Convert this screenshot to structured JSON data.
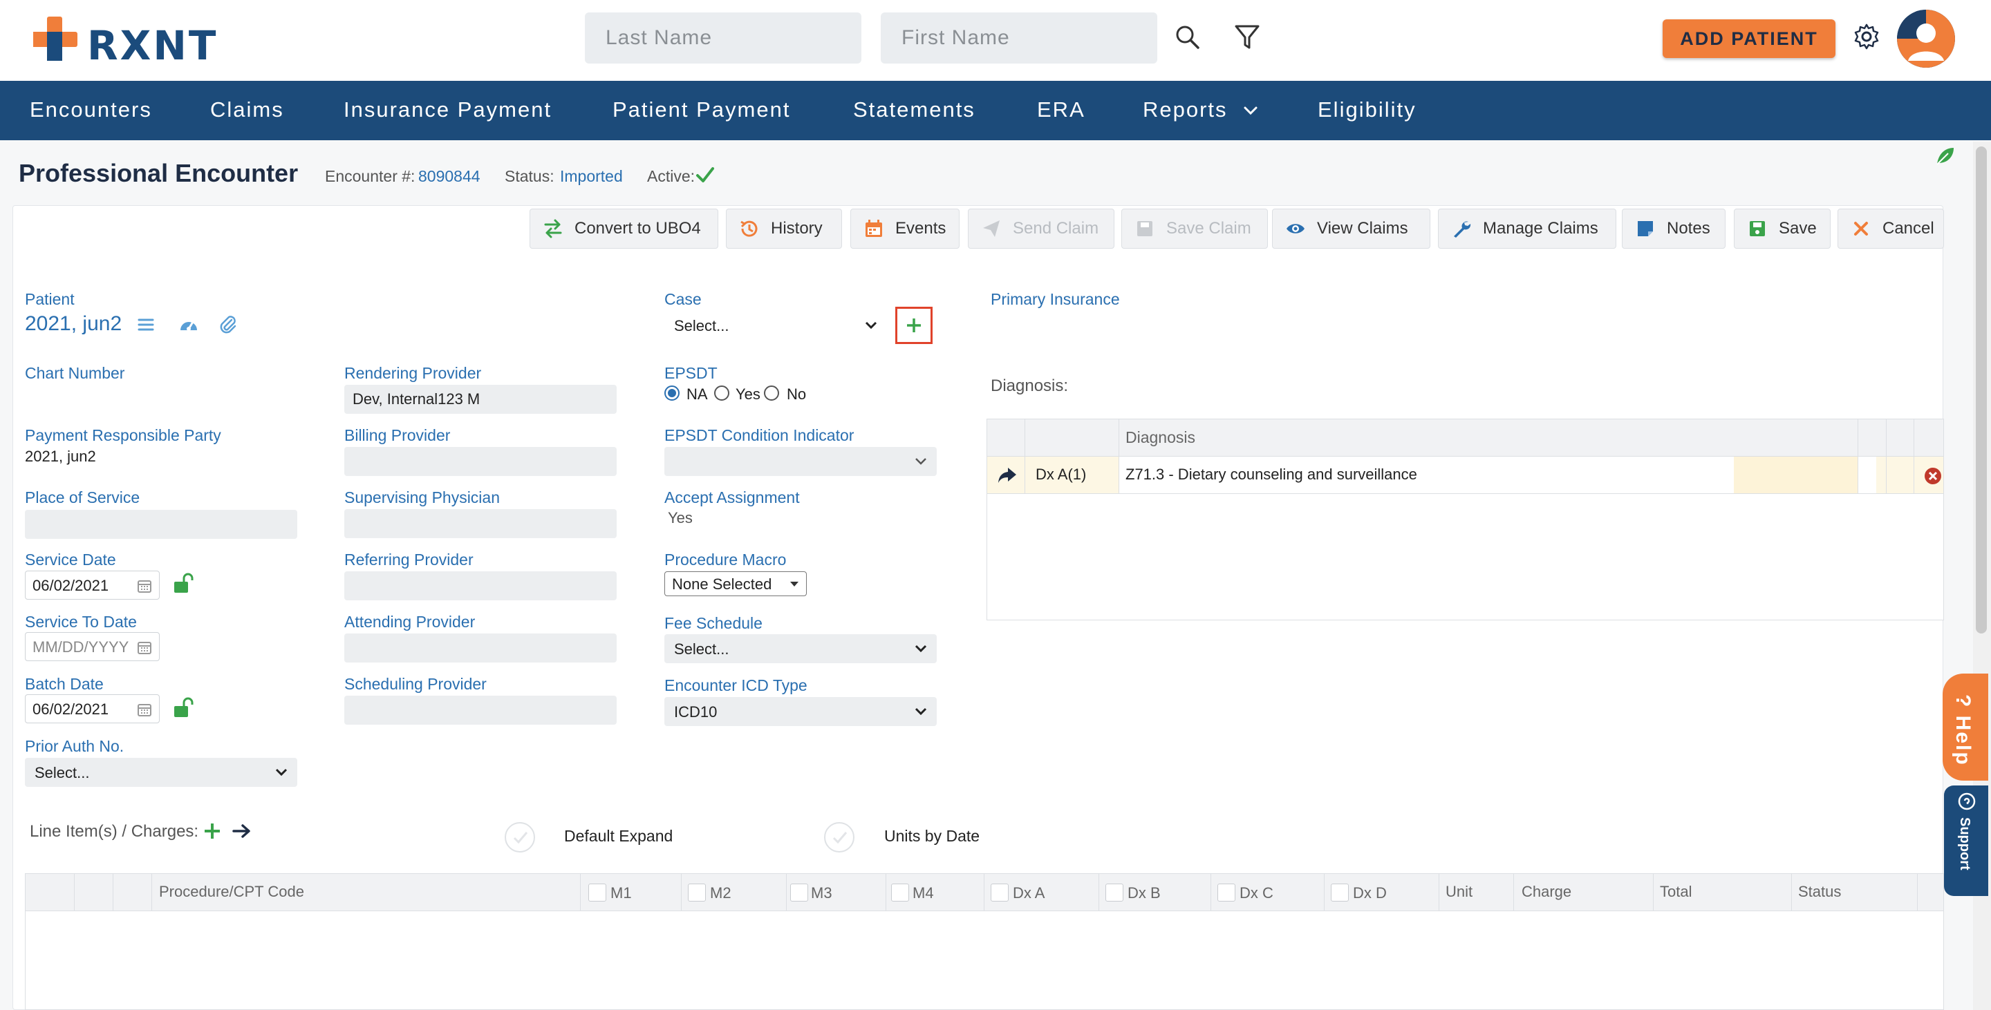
{
  "header": {
    "logo_text": "RXNT",
    "last_name_placeholder": "Last Name",
    "first_name_placeholder": "First Name",
    "add_patient_label": "ADD PATIENT"
  },
  "nav": {
    "items": [
      "Encounters",
      "Claims",
      "Insurance Payment",
      "Patient Payment",
      "Statements",
      "ERA",
      "Reports",
      "Eligibility"
    ]
  },
  "page": {
    "title": "Professional Encounter",
    "encounter_label": "Encounter #:",
    "encounter_number": "8090844",
    "status_label": "Status:",
    "status_value": "Imported",
    "active_label": "Active:"
  },
  "toolbar": {
    "convert": "Convert to UBO4",
    "history": "History",
    "events": "Events",
    "send_claim": "Send Claim",
    "save_claim": "Save Claim",
    "view_claims": "View Claims",
    "manage_claims": "Manage Claims",
    "notes": "Notes",
    "save": "Save",
    "cancel": "Cancel"
  },
  "patient": {
    "label": "Patient",
    "name": "2021, jun2",
    "chart_number_label": "Chart Number",
    "payment_party_label": "Payment Responsible Party",
    "payment_party_value": "2021, jun2",
    "place_of_service_label": "Place of Service",
    "service_date_label": "Service Date",
    "service_date_value": "06/02/2021",
    "service_to_date_label": "Service To Date",
    "service_to_date_placeholder": "MM/DD/YYYY",
    "batch_date_label": "Batch Date",
    "batch_date_value": "06/02/2021",
    "prior_auth_label": "Prior Auth No.",
    "prior_auth_value": "Select..."
  },
  "providers": {
    "rendering_label": "Rendering Provider",
    "rendering_value": "Dev, Internal123 M",
    "billing_label": "Billing Provider",
    "supervising_label": "Supervising Physician",
    "referring_label": "Referring Provider",
    "attending_label": "Attending Provider",
    "scheduling_label": "Scheduling Provider"
  },
  "case": {
    "case_label": "Case",
    "case_value": "Select...",
    "epsdt_label": "EPSDT",
    "epsdt_options": [
      "NA",
      "Yes",
      "No"
    ],
    "epsdt_selected": "NA",
    "epsdt_condition_label": "EPSDT Condition Indicator",
    "accept_assignment_label": "Accept Assignment",
    "accept_assignment_value": "Yes",
    "procedure_macro_label": "Procedure Macro",
    "procedure_macro_value": "None Selected",
    "fee_schedule_label": "Fee Schedule",
    "fee_schedule_value": "Select...",
    "icd_type_label": "Encounter ICD Type",
    "icd_type_value": "ICD10"
  },
  "insurance": {
    "primary_label": "Primary Insurance",
    "diagnosis_label": "Diagnosis:"
  },
  "diagnosis_grid": {
    "header": "Diagnosis",
    "rows": [
      {
        "code_label": "Dx A(1)",
        "description": "Z71.3 - Dietary counseling and surveillance"
      }
    ]
  },
  "line_items": {
    "label": "Line Item(s) / Charges:",
    "default_expand": "Default Expand",
    "units_by_date": "Units by Date",
    "columns": [
      "Procedure/CPT Code",
      "M1",
      "M2",
      "M3",
      "M4",
      "Dx A",
      "Dx B",
      "Dx C",
      "Dx D",
      "Unit",
      "Charge",
      "Total",
      "Status"
    ]
  },
  "side": {
    "help": "Help",
    "support": "Support"
  },
  "colors": {
    "brand_navy": "#1c4b7a",
    "brand_orange": "#f07e3a",
    "link_blue": "#2a6fb0",
    "success_green": "#3aa34a"
  }
}
